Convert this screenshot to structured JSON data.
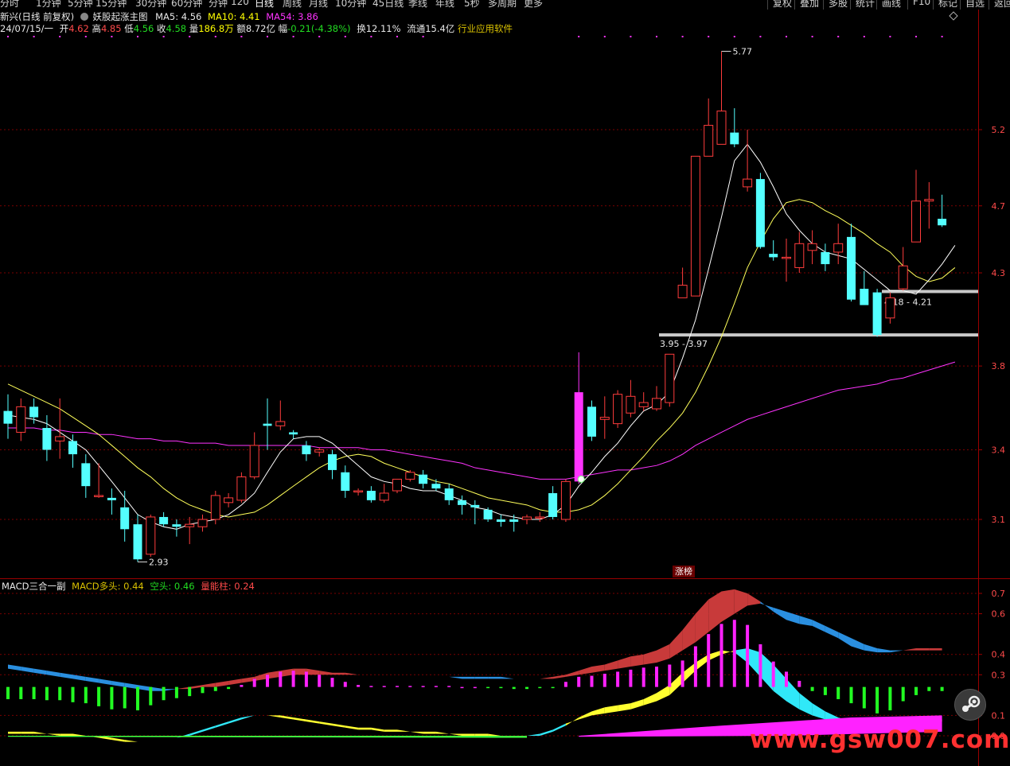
{
  "toolbar": {
    "periods": [
      "分时",
      "1分钟",
      "5分钟",
      "15分钟",
      "30分钟",
      "60分钟",
      "分钟",
      "120",
      "日线",
      "周线",
      "月线",
      "10分钟",
      "45日线",
      "季线",
      "年线",
      "5秒",
      "多周期",
      "更多"
    ],
    "active_period": "日线",
    "right_buttons": [
      "复权",
      "叠加",
      "多股",
      "统计",
      "画线",
      "F10",
      "标记",
      "自选",
      "返回"
    ]
  },
  "header": {
    "stock_name": "新兴(日线 前复权)",
    "indicator_name": "妖股起涨主图",
    "ma5_label": "MA5: 4.56",
    "ma10_label": "MA10: 4.41",
    "ma54_label": "MA54: 3.86",
    "date": "24/07/15/一",
    "open_label": "开",
    "open_value": "4.62",
    "high_label": "高",
    "high_value": "4.85",
    "low_label": "低",
    "low_value": "4.56",
    "close_label": "收",
    "close_value": "4.58",
    "volume_label": "量",
    "volume_value": "186.8万",
    "amount_label": "额",
    "amount_value": "8.72亿",
    "change_label": "幅",
    "change_value": "-0.21(-4.38%)",
    "turnover_label": "换",
    "turnover_value": "12.11%",
    "float_label": "流通",
    "float_value": "15.4亿",
    "industry": "行业应用软件"
  },
  "annotations": {
    "high_mark": "5.77",
    "low_mark": "2.93",
    "zone1_label": "4.18 - 4.21",
    "zone2_label": "3.95 - 3.97",
    "limit_up_tag": "涨榜"
  },
  "sub": {
    "title": "MACD三合一副",
    "bull_label": "MACD多头: 0.44",
    "bear_label": "空头: 0.46",
    "energy_label": "量能柱: 0.24"
  },
  "watermark": "www.gsw007.com",
  "colors": {
    "up": "#ff3c3c",
    "down": "#54ffff",
    "ma5": "#ffffff",
    "ma10": "#ffff5a",
    "ma54": "#ff33ff",
    "grid": "#7a0000"
  },
  "chart_data": [
    {
      "type": "candlestick",
      "y_axis_ticks": [
        5.2,
        4.7,
        4.3,
        3.8,
        3.4,
        3.1
      ],
      "candles": [
        {
          "o": 3.58,
          "h": 3.66,
          "l": 3.45,
          "c": 3.52
        },
        {
          "o": 3.48,
          "h": 3.64,
          "l": 3.44,
          "c": 3.6
        },
        {
          "o": 3.6,
          "h": 3.64,
          "l": 3.52,
          "c": 3.55
        },
        {
          "o": 3.5,
          "h": 3.56,
          "l": 3.35,
          "c": 3.4
        },
        {
          "o": 3.44,
          "h": 3.64,
          "l": 3.36,
          "c": 3.46
        },
        {
          "o": 3.44,
          "h": 3.47,
          "l": 3.32,
          "c": 3.38
        },
        {
          "o": 3.34,
          "h": 3.38,
          "l": 3.19,
          "c": 3.24
        },
        {
          "o": 3.2,
          "h": 3.34,
          "l": 3.19,
          "c": 3.2
        },
        {
          "o": 3.19,
          "h": 3.23,
          "l": 3.12,
          "c": 3.18
        },
        {
          "o": 3.15,
          "h": 3.22,
          "l": 3.01,
          "c": 3.06
        },
        {
          "o": 3.08,
          "h": 3.12,
          "l": 2.93,
          "c": 2.94
        },
        {
          "o": 2.96,
          "h": 3.12,
          "l": 2.95,
          "c": 3.11
        },
        {
          "o": 3.11,
          "h": 3.13,
          "l": 3.07,
          "c": 3.08
        },
        {
          "o": 3.08,
          "h": 3.1,
          "l": 3.03,
          "c": 3.07
        },
        {
          "o": 3.07,
          "h": 3.11,
          "l": 3.0,
          "c": 3.08
        },
        {
          "o": 3.07,
          "h": 3.12,
          "l": 3.05,
          "c": 3.1
        },
        {
          "o": 3.1,
          "h": 3.22,
          "l": 3.08,
          "c": 3.2
        },
        {
          "o": 3.17,
          "h": 3.21,
          "l": 3.15,
          "c": 3.19
        },
        {
          "o": 3.18,
          "h": 3.3,
          "l": 3.17,
          "c": 3.28
        },
        {
          "o": 3.28,
          "h": 3.48,
          "l": 3.27,
          "c": 3.42
        },
        {
          "o": 3.52,
          "h": 3.64,
          "l": 3.4,
          "c": 3.51
        },
        {
          "o": 3.51,
          "h": 3.63,
          "l": 3.49,
          "c": 3.53
        },
        {
          "o": 3.48,
          "h": 3.49,
          "l": 3.45,
          "c": 3.47
        },
        {
          "o": 3.42,
          "h": 3.44,
          "l": 3.35,
          "c": 3.38
        },
        {
          "o": 3.39,
          "h": 3.41,
          "l": 3.37,
          "c": 3.4
        },
        {
          "o": 3.38,
          "h": 3.4,
          "l": 3.27,
          "c": 3.31
        },
        {
          "o": 3.3,
          "h": 3.33,
          "l": 3.19,
          "c": 3.22
        },
        {
          "o": 3.22,
          "h": 3.23,
          "l": 3.2,
          "c": 3.22
        },
        {
          "o": 3.22,
          "h": 3.24,
          "l": 3.17,
          "c": 3.18
        },
        {
          "o": 3.18,
          "h": 3.25,
          "l": 3.17,
          "c": 3.21
        },
        {
          "o": 3.22,
          "h": 3.27,
          "l": 3.21,
          "c": 3.27
        },
        {
          "o": 3.27,
          "h": 3.31,
          "l": 3.26,
          "c": 3.3
        },
        {
          "o": 3.29,
          "h": 3.31,
          "l": 3.23,
          "c": 3.25
        },
        {
          "o": 3.25,
          "h": 3.27,
          "l": 3.22,
          "c": 3.23
        },
        {
          "o": 3.23,
          "h": 3.25,
          "l": 3.16,
          "c": 3.18
        },
        {
          "o": 3.18,
          "h": 3.2,
          "l": 3.12,
          "c": 3.16
        },
        {
          "o": 3.16,
          "h": 3.18,
          "l": 3.08,
          "c": 3.15
        },
        {
          "o": 3.14,
          "h": 3.15,
          "l": 3.09,
          "c": 3.1
        },
        {
          "o": 3.1,
          "h": 3.12,
          "l": 3.07,
          "c": 3.09
        },
        {
          "o": 3.1,
          "h": 3.12,
          "l": 3.05,
          "c": 3.09
        },
        {
          "o": 3.1,
          "h": 3.12,
          "l": 3.08,
          "c": 3.11
        },
        {
          "o": 3.11,
          "h": 3.13,
          "l": 3.09,
          "c": 3.11
        },
        {
          "o": 3.21,
          "h": 3.24,
          "l": 3.1,
          "c": 3.11
        },
        {
          "o": 3.1,
          "h": 3.27,
          "l": 3.09,
          "c": 3.26
        },
        {
          "o": 3.26,
          "h": 3.87,
          "l": 3.25,
          "c": 3.67
        },
        {
          "o": 3.6,
          "h": 3.63,
          "l": 3.44,
          "c": 3.46
        },
        {
          "o": 3.54,
          "h": 3.65,
          "l": 3.45,
          "c": 3.55
        },
        {
          "o": 3.52,
          "h": 3.68,
          "l": 3.5,
          "c": 3.66
        },
        {
          "o": 3.57,
          "h": 3.73,
          "l": 3.55,
          "c": 3.65
        },
        {
          "o": 3.6,
          "h": 3.67,
          "l": 3.58,
          "c": 3.62
        },
        {
          "o": 3.59,
          "h": 3.7,
          "l": 3.58,
          "c": 3.64
        },
        {
          "o": 3.62,
          "h": 3.82,
          "l": 3.6,
          "c": 3.86
        },
        {
          "o": 4.16,
          "h": 4.33,
          "l": 4.16,
          "c": 4.23
        },
        {
          "o": 4.17,
          "h": 5.01,
          "l": 4.17,
          "c": 5.02
        },
        {
          "o": 5.02,
          "h": 5.42,
          "l": 5.02,
          "c": 5.23
        },
        {
          "o": 5.1,
          "h": 5.77,
          "l": 5.1,
          "c": 5.33
        },
        {
          "o": 5.18,
          "h": 5.35,
          "l": 5.08,
          "c": 5.1
        },
        {
          "o": 4.82,
          "h": 5.2,
          "l": 4.79,
          "c": 4.87
        },
        {
          "o": 4.87,
          "h": 4.91,
          "l": 4.44,
          "c": 4.45
        },
        {
          "o": 4.41,
          "h": 4.49,
          "l": 4.37,
          "c": 4.39
        },
        {
          "o": 4.39,
          "h": 4.5,
          "l": 4.25,
          "c": 4.39
        },
        {
          "o": 4.33,
          "h": 4.54,
          "l": 4.3,
          "c": 4.47
        },
        {
          "o": 4.43,
          "h": 4.55,
          "l": 4.35,
          "c": 4.47
        },
        {
          "o": 4.42,
          "h": 4.47,
          "l": 4.31,
          "c": 4.35
        },
        {
          "o": 4.42,
          "h": 4.59,
          "l": 4.35,
          "c": 4.47
        },
        {
          "o": 4.51,
          "h": 4.59,
          "l": 4.14,
          "c": 4.15
        },
        {
          "o": 4.21,
          "h": 4.31,
          "l": 4.12,
          "c": 4.12
        },
        {
          "o": 4.19,
          "h": 4.21,
          "l": 3.95,
          "c": 3.96
        },
        {
          "o": 4.05,
          "h": 4.19,
          "l": 4.02,
          "c": 4.16
        },
        {
          "o": 4.21,
          "h": 4.45,
          "l": 4.2,
          "c": 4.34
        },
        {
          "o": 4.48,
          "h": 4.93,
          "l": 4.48,
          "c": 4.73
        },
        {
          "o": 4.73,
          "h": 4.85,
          "l": 4.56,
          "c": 4.74
        },
        {
          "o": 4.62,
          "h": 4.77,
          "l": 4.57,
          "c": 4.58
        }
      ],
      "ma5": [
        3.56,
        3.55,
        3.54,
        3.52,
        3.48,
        3.44,
        3.4,
        3.33,
        3.26,
        3.19,
        3.12,
        3.09,
        3.07,
        3.06,
        3.08,
        3.09,
        3.1,
        3.12,
        3.16,
        3.21,
        3.3,
        3.39,
        3.45,
        3.46,
        3.46,
        3.43,
        3.38,
        3.33,
        3.28,
        3.26,
        3.25,
        3.23,
        3.22,
        3.22,
        3.2,
        3.18,
        3.15,
        3.14,
        3.12,
        3.11,
        3.1,
        3.1,
        3.12,
        3.16,
        3.24,
        3.3,
        3.37,
        3.43,
        3.51,
        3.58,
        3.61,
        3.67,
        3.84,
        4.04,
        4.32,
        4.63,
        4.99,
        5.1,
        4.98,
        4.82,
        4.65,
        4.55,
        4.47,
        4.42,
        4.4,
        4.38,
        4.32,
        4.26,
        4.2,
        4.2,
        4.18,
        4.26,
        4.35,
        4.46
      ],
      "ma10": [
        3.71,
        3.68,
        3.65,
        3.62,
        3.59,
        3.55,
        3.51,
        3.47,
        3.42,
        3.37,
        3.32,
        3.28,
        3.23,
        3.19,
        3.16,
        3.14,
        3.12,
        3.11,
        3.12,
        3.13,
        3.16,
        3.2,
        3.24,
        3.28,
        3.32,
        3.35,
        3.37,
        3.38,
        3.37,
        3.34,
        3.32,
        3.3,
        3.28,
        3.26,
        3.25,
        3.23,
        3.21,
        3.19,
        3.18,
        3.17,
        3.16,
        3.14,
        3.13,
        3.13,
        3.14,
        3.16,
        3.2,
        3.25,
        3.31,
        3.37,
        3.44,
        3.5,
        3.57,
        3.67,
        3.8,
        3.95,
        4.13,
        4.33,
        4.48,
        4.62,
        4.72,
        4.74,
        4.72,
        4.67,
        4.63,
        4.58,
        4.53,
        4.47,
        4.42,
        4.34,
        4.28,
        4.25,
        4.27,
        4.33
      ],
      "ma54": [
        3.5,
        3.5,
        3.5,
        3.49,
        3.49,
        3.48,
        3.48,
        3.47,
        3.47,
        3.46,
        3.45,
        3.45,
        3.44,
        3.44,
        3.43,
        3.43,
        3.43,
        3.42,
        3.42,
        3.42,
        3.42,
        3.42,
        3.42,
        3.42,
        3.41,
        3.41,
        3.41,
        3.41,
        3.4,
        3.4,
        3.39,
        3.38,
        3.37,
        3.36,
        3.35,
        3.34,
        3.32,
        3.31,
        3.3,
        3.29,
        3.28,
        3.27,
        3.27,
        3.27,
        3.28,
        3.29,
        3.3,
        3.31,
        3.31,
        3.32,
        3.33,
        3.35,
        3.38,
        3.42,
        3.45,
        3.48,
        3.51,
        3.54,
        3.56,
        3.58,
        3.6,
        3.62,
        3.64,
        3.66,
        3.68,
        3.69,
        3.7,
        3.71,
        3.73,
        3.74,
        3.76,
        3.78,
        3.8,
        3.82
      ]
    },
    {
      "type": "bar",
      "y_axis_ticks": [
        0.7,
        0.6,
        0.4,
        0.3,
        0.1,
        0.0
      ],
      "histogram": [
        -0.12,
        -0.12,
        -0.12,
        -0.13,
        -0.13,
        -0.15,
        -0.16,
        -0.19,
        -0.22,
        -0.21,
        -0.23,
        -0.18,
        -0.13,
        -0.11,
        -0.09,
        -0.06,
        -0.04,
        -0.02,
        0.02,
        0.08,
        0.12,
        0.15,
        0.16,
        0.15,
        0.12,
        0.09,
        0.05,
        0.02,
        0.01,
        0.01,
        0.01,
        0.01,
        0.01,
        0.01,
        0.01,
        0.0,
        0.0,
        -0.01,
        -0.01,
        -0.02,
        -0.02,
        -0.01,
        -0.01,
        0.05,
        0.1,
        0.11,
        0.13,
        0.15,
        0.17,
        0.19,
        0.2,
        0.22,
        0.26,
        0.4,
        0.52,
        0.62,
        0.66,
        0.61,
        0.42,
        0.25,
        0.15,
        0.06,
        -0.04,
        -0.08,
        -0.12,
        -0.16,
        -0.21,
        -0.26,
        -0.23,
        -0.14,
        -0.08,
        -0.04,
        -0.04
      ],
      "dif": [
        0.33,
        0.32,
        0.31,
        0.3,
        0.29,
        0.28,
        0.27,
        0.26,
        0.25,
        0.24,
        0.23,
        0.22,
        0.22,
        0.23,
        0.24,
        0.25,
        0.26,
        0.27,
        0.28,
        0.29,
        0.31,
        0.32,
        0.33,
        0.33,
        0.32,
        0.31,
        0.31,
        0.3,
        0.3,
        0.3,
        0.3,
        0.3,
        0.3,
        0.29,
        0.29,
        0.28,
        0.28,
        0.28,
        0.28,
        0.28,
        0.28,
        0.28,
        0.29,
        0.3,
        0.32,
        0.34,
        0.35,
        0.37,
        0.39,
        0.4,
        0.42,
        0.45,
        0.52,
        0.6,
        0.67,
        0.71,
        0.72,
        0.7,
        0.66,
        0.61,
        0.57,
        0.55,
        0.54,
        0.51,
        0.48,
        0.44,
        0.42,
        0.41,
        0.41,
        0.42,
        0.43,
        0.43,
        0.43
      ],
      "dea": [
        0.35,
        0.34,
        0.33,
        0.32,
        0.31,
        0.3,
        0.29,
        0.28,
        0.27,
        0.26,
        0.25,
        0.24,
        0.23,
        0.23,
        0.23,
        0.24,
        0.24,
        0.25,
        0.26,
        0.27,
        0.28,
        0.29,
        0.3,
        0.3,
        0.3,
        0.3,
        0.3,
        0.3,
        0.3,
        0.3,
        0.3,
        0.3,
        0.3,
        0.29,
        0.29,
        0.29,
        0.29,
        0.29,
        0.29,
        0.28,
        0.28,
        0.28,
        0.28,
        0.29,
        0.3,
        0.31,
        0.32,
        0.33,
        0.34,
        0.35,
        0.36,
        0.38,
        0.42,
        0.46,
        0.51,
        0.56,
        0.6,
        0.64,
        0.65,
        0.63,
        0.61,
        0.59,
        0.57,
        0.54,
        0.51,
        0.48,
        0.45,
        0.43,
        0.42,
        0.42,
        0.42,
        0.42,
        0.42
      ],
      "line_a": [
        0.02,
        0.02,
        0.02,
        0.01,
        0.01,
        0.01,
        0.0,
        0.0,
        -0.01,
        -0.02,
        -0.03,
        -0.03,
        -0.02,
        -0.01,
        0.0,
        0.02,
        0.04,
        0.06,
        0.08,
        0.1,
        0.1,
        0.1,
        0.09,
        0.08,
        0.07,
        0.06,
        0.05,
        0.04,
        0.04,
        0.03,
        0.03,
        0.02,
        0.02,
        0.02,
        0.01,
        0.01,
        0.01,
        0.01,
        0.0,
        0.0,
        0.0,
        0.0,
        0.02,
        0.05,
        0.09,
        0.12,
        0.14,
        0.15,
        0.16,
        0.18,
        0.21,
        0.25,
        0.31,
        0.36,
        0.4,
        0.42,
        0.41,
        0.36,
        0.29,
        0.22,
        0.17,
        0.13,
        0.1,
        0.08,
        0.06,
        0.05,
        0.04,
        0.04,
        0.05,
        0.06,
        0.07,
        0.08,
        0.08
      ],
      "line_b": [
        0.01,
        0.01,
        0.01,
        0.01,
        0.0,
        0.0,
        0.0,
        -0.01,
        -0.02,
        -0.03,
        -0.03,
        -0.03,
        -0.02,
        -0.01,
        0.01,
        0.03,
        0.05,
        0.07,
        0.09,
        0.1,
        0.1,
        0.09,
        0.08,
        0.07,
        0.06,
        0.05,
        0.04,
        0.03,
        0.03,
        0.02,
        0.02,
        0.02,
        0.01,
        0.01,
        0.01,
        0.0,
        0.0,
        0.0,
        0.0,
        0.0,
        0.0,
        0.01,
        0.03,
        0.06,
        0.08,
        0.1,
        0.11,
        0.12,
        0.13,
        0.15,
        0.17,
        0.2,
        0.26,
        0.32,
        0.37,
        0.4,
        0.42,
        0.43,
        0.41,
        0.35,
        0.28,
        0.21,
        0.16,
        0.12,
        0.09,
        0.07,
        0.06,
        0.05,
        0.04,
        0.05,
        0.06,
        0.07,
        0.07
      ]
    }
  ]
}
